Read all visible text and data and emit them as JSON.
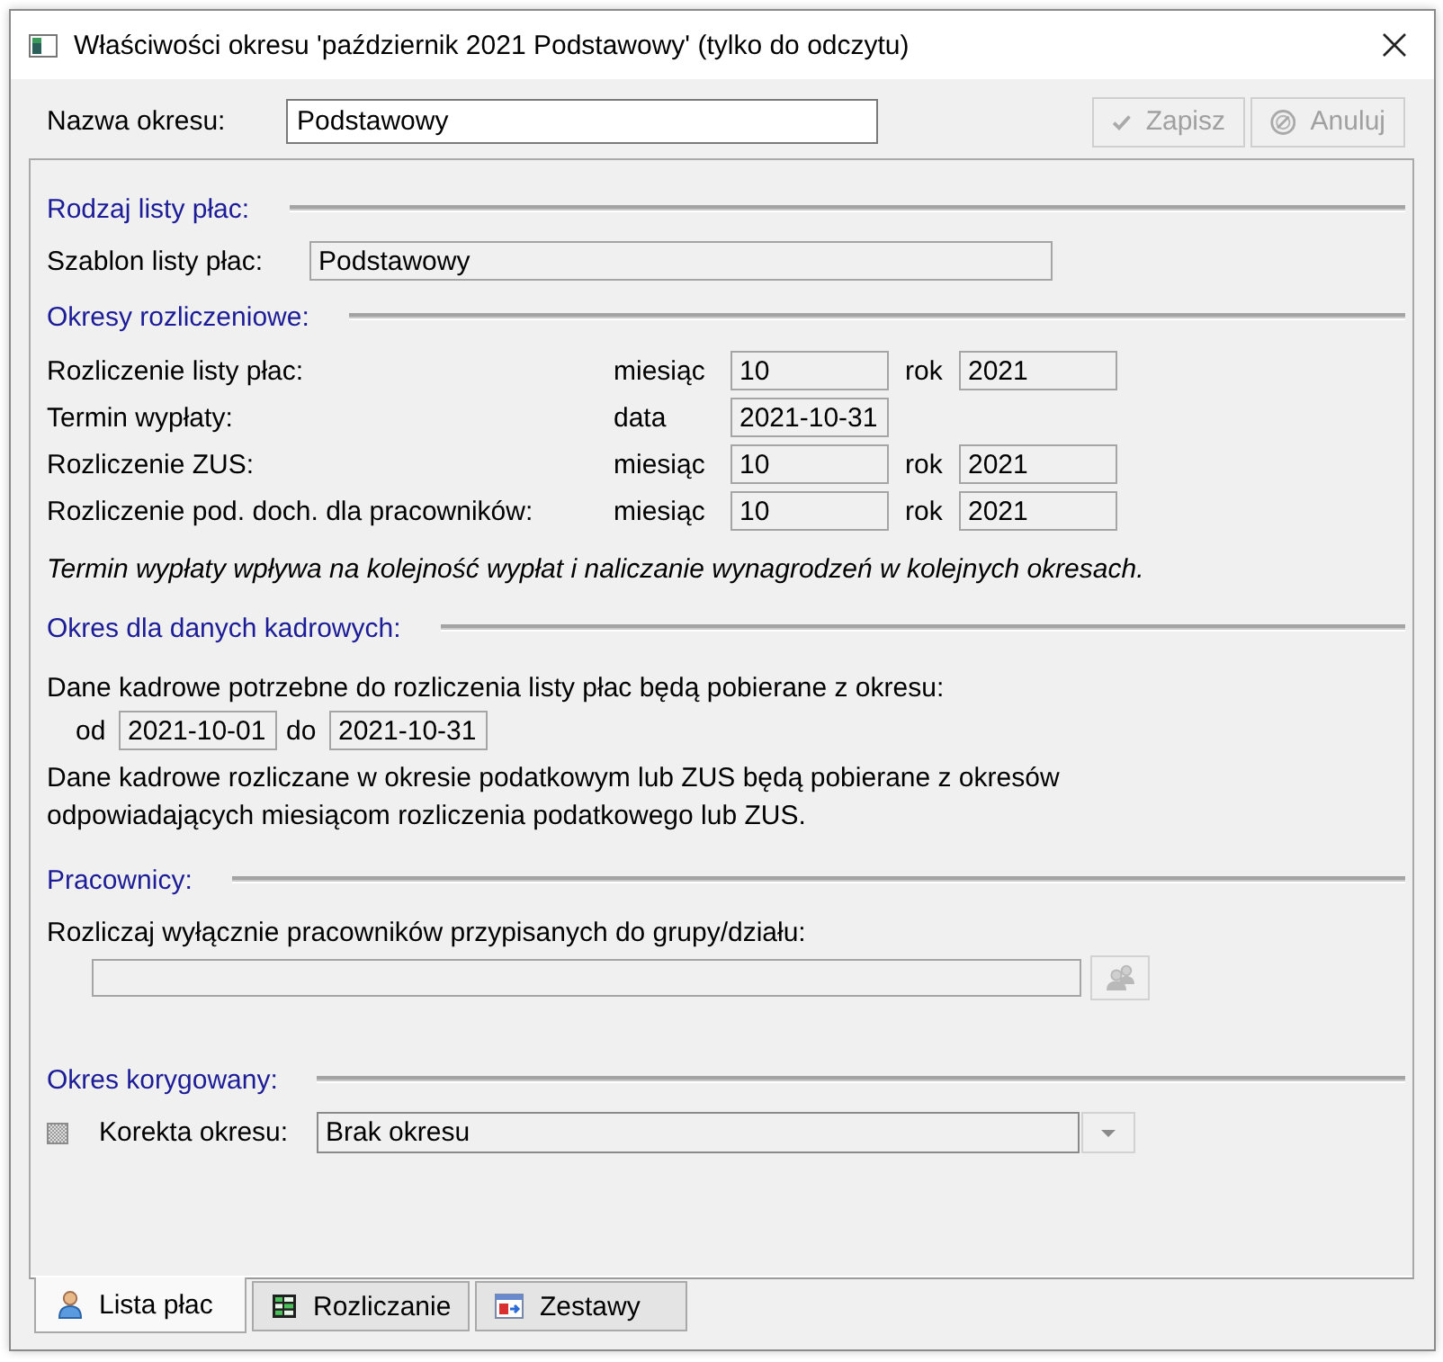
{
  "window": {
    "title": "Właściwości okresu 'październik 2021 Podstawowy' (tylko do odczytu)"
  },
  "header": {
    "name_label": "Nazwa okresu:",
    "name_value": "Podstawowy",
    "buttons": [
      {
        "kind": "save",
        "label": "Zapisz",
        "disabled": true
      },
      {
        "kind": "cancel",
        "label": "Anuluj",
        "disabled": true
      }
    ]
  },
  "payroll_type": {
    "heading": "Rodzaj listy płac:",
    "template_label": "Szablon listy płac:",
    "template_value": "Podstawowy"
  },
  "settlement_periods": {
    "heading": "Okresy rozliczeniowe:",
    "rows": [
      {
        "label": "Rozliczenie listy płac:",
        "fields": [
          {
            "label": "miesiąc",
            "value": "10"
          },
          {
            "label": "rok",
            "value": "2021"
          }
        ]
      },
      {
        "label": "Termin wypłaty:",
        "fields": [
          {
            "label": "data",
            "value": "2021-10-31"
          }
        ]
      },
      {
        "label": "Rozliczenie ZUS:",
        "fields": [
          {
            "label": "miesiąc",
            "value": "10"
          },
          {
            "label": "rok",
            "value": "2021"
          }
        ]
      },
      {
        "label": "Rozliczenie pod. doch. dla pracowników:",
        "fields": [
          {
            "label": "miesiąc",
            "value": "10"
          },
          {
            "label": "rok",
            "value": "2021"
          }
        ]
      }
    ],
    "note": "Termin wypłaty wpływa na kolejność wypłat i naliczanie wynagrodzeń w kolejnych okresach."
  },
  "hr_data_period": {
    "heading": "Okres dla danych kadrowych:",
    "intro": "Dane kadrowe potrzebne do rozliczenia listy płac będą pobierane z okresu:",
    "from_label": "od",
    "from_value": "2021-10-01",
    "to_label": "do",
    "to_value": "2021-10-31",
    "note": "Dane kadrowe rozliczane w okresie podatkowym lub ZUS będą pobierane z okresów odpowiadających miesiącom rozliczenia podatkowego lub ZUS."
  },
  "employees": {
    "heading": "Pracownicy:",
    "label": "Rozliczaj wyłącznie pracowników przypisanych do grupy/działu:",
    "group_button": {
      "disabled": true
    }
  },
  "corrected_period": {
    "heading": "Okres korygowany:",
    "checkbox": {
      "label": "Korekta okresu:",
      "checked": false,
      "disabled": true
    },
    "value": "Brak okresu"
  },
  "tabs": [
    {
      "kind": "payroll",
      "label": "Lista płac",
      "selected": true
    },
    {
      "kind": "calculation",
      "label": "Rozliczanie",
      "selected": false
    },
    {
      "kind": "sets",
      "label": "Zestawy",
      "selected": false
    }
  ]
}
